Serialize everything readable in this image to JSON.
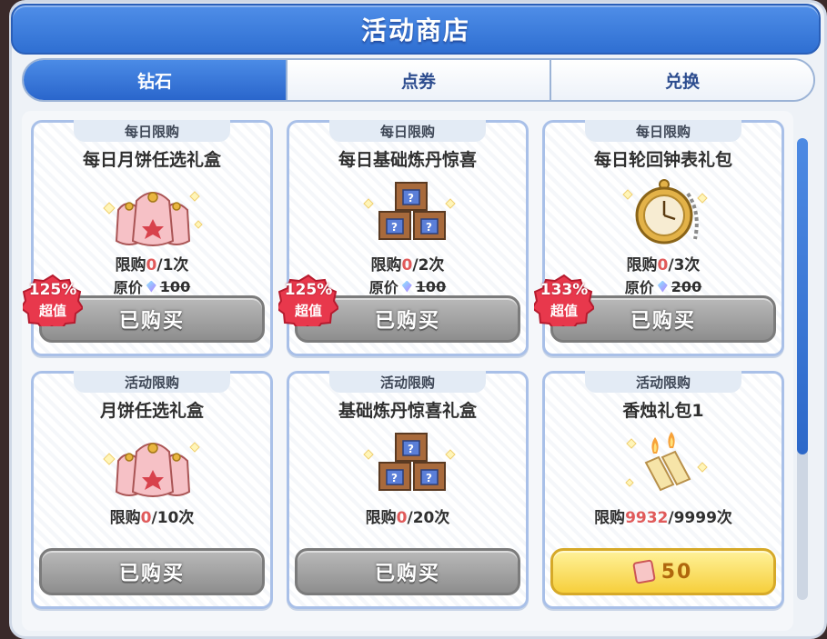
{
  "header": {
    "title": "活动商店"
  },
  "tabs": [
    {
      "label": "钻石",
      "active": true
    },
    {
      "label": "点券",
      "active": false
    },
    {
      "label": "兑换",
      "active": false
    }
  ],
  "cards": [
    {
      "tag": "每日限购",
      "name": "每日月饼任选礼盒",
      "limit_prefix": "限购",
      "limit_used": "0",
      "limit_total": "/1次",
      "orig_label": "原价",
      "orig_price": "100",
      "button": "已购买",
      "badge_pct": "125%",
      "badge_sub": "超值"
    },
    {
      "tag": "每日限购",
      "name": "每日基础炼丹惊喜",
      "limit_prefix": "限购",
      "limit_used": "0",
      "limit_total": "/2次",
      "orig_label": "原价",
      "orig_price": "100",
      "button": "已购买",
      "badge_pct": "125%",
      "badge_sub": "超值"
    },
    {
      "tag": "每日限购",
      "name": "每日轮回钟表礼包",
      "limit_prefix": "限购",
      "limit_used": "0",
      "limit_total": "/3次",
      "orig_label": "原价",
      "orig_price": "200",
      "button": "已购买",
      "badge_pct": "133%",
      "badge_sub": "超值"
    },
    {
      "tag": "活动限购",
      "name": "月饼任选礼盒",
      "limit_prefix": "限购",
      "limit_used": "0",
      "limit_total": "/10次",
      "button": "已购买"
    },
    {
      "tag": "活动限购",
      "name": "基础炼丹惊喜礼盒",
      "limit_prefix": "限购",
      "limit_used": "0",
      "limit_total": "/20次",
      "button": "已购买"
    },
    {
      "tag": "活动限购",
      "name": "香烛礼包1",
      "limit_prefix": "限购",
      "limit_used": "9932",
      "limit_total": "/9999次",
      "button": "50"
    }
  ],
  "colors": {
    "accent": "#2f6fd2",
    "limit_used": "#e05a5a",
    "gold_button": "#f6cf3c"
  },
  "icons": [
    "mooncake-bag-icon",
    "alchemy-box-icon",
    "pocket-watch-icon",
    "candle-icon",
    "gem-icon",
    "ticket-icon",
    "sale-badge-icon"
  ]
}
